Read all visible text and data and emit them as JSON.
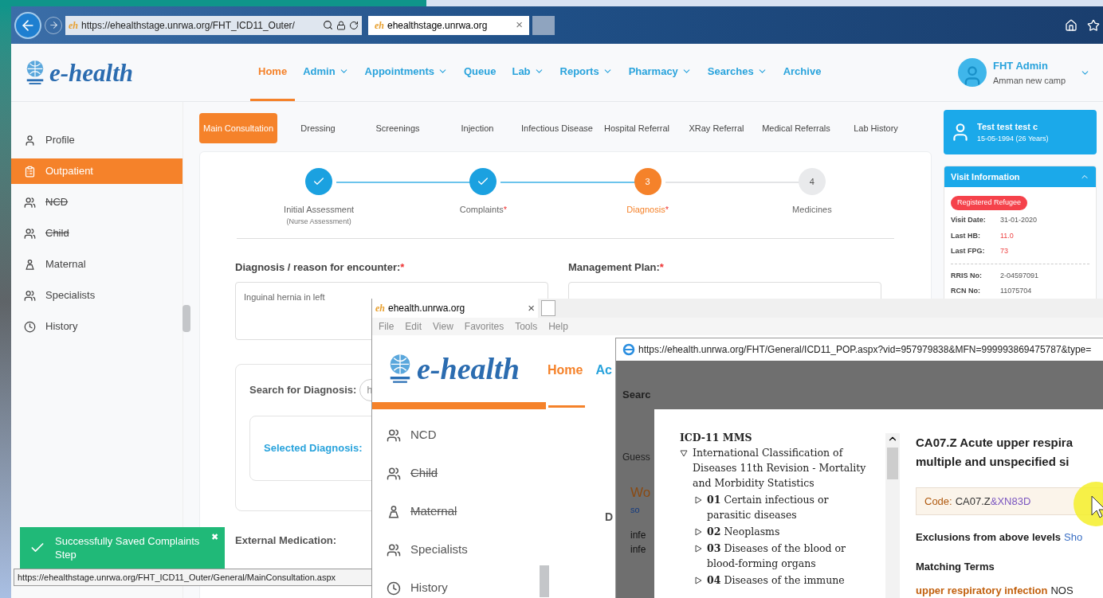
{
  "browser": {
    "favicon": "eh",
    "address": "https://ehealthstage.unrwa.org/FHT_ICD11_Outer/",
    "tab_favicon": "eh",
    "tab": "ehealthstage.unrwa.org",
    "tab_close": "×"
  },
  "header": {
    "logo": "e-health",
    "nav": [
      {
        "label": "Home",
        "selected": true,
        "dropdown": false
      },
      {
        "label": "Admin",
        "selected": false,
        "dropdown": true
      },
      {
        "label": "Appointments",
        "selected": false,
        "dropdown": true
      },
      {
        "label": "Queue",
        "selected": false,
        "dropdown": false
      },
      {
        "label": "Lab",
        "selected": false,
        "dropdown": true
      },
      {
        "label": "Reports",
        "selected": false,
        "dropdown": true
      },
      {
        "label": "Pharmacy",
        "selected": false,
        "dropdown": true
      },
      {
        "label": "Searches",
        "selected": false,
        "dropdown": true
      },
      {
        "label": "Archive",
        "selected": false,
        "dropdown": false
      }
    ],
    "user": {
      "name": "FHT Admin",
      "location": "Amman new camp"
    }
  },
  "sidebar": [
    {
      "label": "Profile",
      "kind": "person",
      "selected": false,
      "struck": false
    },
    {
      "label": "Outpatient",
      "kind": "clipboard",
      "selected": true,
      "struck": false
    },
    {
      "label": "NCD",
      "kind": "group",
      "selected": false,
      "struck": true
    },
    {
      "label": "Child",
      "kind": "group",
      "selected": false,
      "struck": true
    },
    {
      "label": "Maternal",
      "kind": "mother",
      "selected": false,
      "struck": false
    },
    {
      "label": "Specialists",
      "kind": "group",
      "selected": false,
      "struck": false
    },
    {
      "label": "History",
      "kind": "history",
      "selected": false,
      "struck": false
    }
  ],
  "tabs": [
    {
      "label": "Main Consultation",
      "selected": true
    },
    {
      "label": "Dressing",
      "selected": false
    },
    {
      "label": "Screenings",
      "selected": false
    },
    {
      "label": "Injection",
      "selected": false
    },
    {
      "label": "Infectious Disease",
      "selected": false
    },
    {
      "label": "Hospital Referral",
      "selected": false
    },
    {
      "label": "XRay Referral",
      "selected": false
    },
    {
      "label": "Medical Referrals",
      "selected": false
    },
    {
      "label": "Lab History",
      "selected": false
    }
  ],
  "steps": [
    {
      "label": "Initial Assessment",
      "sublabel": "(Nurse Assessment)",
      "completed": true,
      "selected": false
    },
    {
      "label": "Complaints",
      "mark": "*",
      "completed": true,
      "selected": false
    },
    {
      "label": "Diagnosis",
      "mark": "*",
      "number": "3",
      "completed": false,
      "selected": true
    },
    {
      "label": "Medicines",
      "number": "4",
      "completed": false,
      "selected": false
    }
  ],
  "form": {
    "diagnosis_label": "Diagnosis / reason for encounter:",
    "diagnosis_mark": "*",
    "diagnosis_value": "Inguinal hernia in left",
    "plan_label": "Management Plan:",
    "plan_mark": "*",
    "search_label": "Search for Diagnosis:",
    "search_value": "h",
    "selected_label": "Selected Diagnosis:",
    "external_label": "External Medication:"
  },
  "patient": {
    "name": "Test test test c",
    "dob": "15-05-1994 (26 Years)"
  },
  "visit": {
    "title": "Visit Information",
    "expanded": true,
    "badge": "Registered Refugee",
    "rows": [
      {
        "label": "Visit Date:",
        "value": "31-01-2020",
        "alert": false
      },
      {
        "label": "Last HB:",
        "value": "11.0",
        "alert": true
      },
      {
        "label": "Last FPG:",
        "value": "73",
        "alert": true
      }
    ],
    "ids": [
      {
        "label": "RRIS No:",
        "value": "2-04597091"
      },
      {
        "label": "RCN No:",
        "value": "11075704"
      }
    ]
  },
  "toast": {
    "message": "Successfully Saved Complaints Step",
    "close": "✖"
  },
  "status_url": "https://ehealthstage.unrwa.org/FHT_ICD11_Outer/General/MainConsultation.aspx",
  "window2": {
    "tab_favicon": "eh",
    "tab": "ehealth.unrwa.org",
    "tab_close": "×",
    "menu": [
      "File",
      "Edit",
      "View",
      "Favorites",
      "Tools",
      "Help"
    ],
    "logo": "e-health",
    "nav": [
      {
        "label": "Home",
        "selected": true
      },
      {
        "label": "Ac",
        "selected": false
      }
    ],
    "sidebar": [
      {
        "label": "NCD",
        "kind": "group",
        "struck": false
      },
      {
        "label": "Child",
        "kind": "group",
        "struck": true
      },
      {
        "label": "Maternal",
        "kind": "mother",
        "struck": true
      },
      {
        "label": "Specialists",
        "kind": "group",
        "struck": false
      },
      {
        "label": "History",
        "kind": "history",
        "struck": false
      }
    ],
    "behind": {
      "search": "Searc",
      "guess": "Guess",
      "result_title": "Wo",
      "result_sub": "so",
      "lines": [
        "infe",
        "infe"
      ],
      "side": "D"
    }
  },
  "popup": {
    "url": "https://ehealth.unrwa.org/FHT/General/ICD11_POP.aspx?vid=957979838&MFN=999993869475787&type=",
    "tree_title": "ICD-11 MMS",
    "tree": [
      {
        "label": "International Classification of Diseases 11th Revision - Mortality and Morbidity Statistics",
        "expanded": true,
        "children": [
          {
            "code": "01",
            "label": "Certain infectious or parasitic diseases",
            "expanded": false
          },
          {
            "code": "02",
            "label": "Neoplasms",
            "expanded": false
          },
          {
            "code": "03",
            "label": "Diseases of the blood or blood-forming organs",
            "expanded": false
          },
          {
            "code": "04",
            "label": "Diseases of the immune",
            "expanded": false
          }
        ]
      }
    ],
    "title_lines": [
      "CA07.Z Acute upper respira",
      "multiple and unspecified si"
    ],
    "code_label": "Code:",
    "code_value": "CA07.Z",
    "code_extra": "&XN83D",
    "exclusions": "Exclusions from above levels",
    "show_link": "Sho",
    "matching": "Matching Terms",
    "term": "upper respiratory infection",
    "term_rest": "NOS"
  }
}
